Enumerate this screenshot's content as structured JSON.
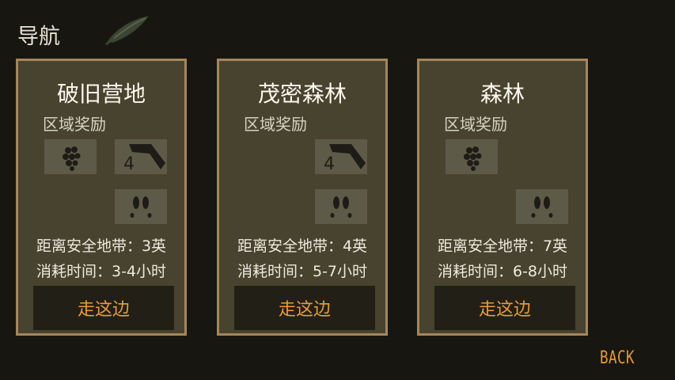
{
  "header": {
    "title": "导航",
    "icon": "leaf-compass-icon"
  },
  "colors": {
    "accent": "#eb9d33",
    "card_border": "#a4875b",
    "card_bg": "#48432e"
  },
  "cards": [
    {
      "title": "破旧营地",
      "reward_label": "区域奖励",
      "rewards": [
        "berries-icon",
        "hatchet-icon",
        "animal-tracks-icon"
      ],
      "distance_label": "距离安全地带：",
      "distance_value": "3英",
      "time_label": "消耗时间：",
      "time_value": "3-4小时",
      "go_label": "走这边"
    },
    {
      "title": "茂密森林",
      "reward_label": "区域奖励",
      "rewards": [
        "hatchet-icon",
        "animal-tracks-icon"
      ],
      "distance_label": "距离安全地带：",
      "distance_value": "4英",
      "time_label": "消耗时间：",
      "time_value": "5-7小时",
      "go_label": "走这边"
    },
    {
      "title": "森林",
      "reward_label": "区域奖励",
      "rewards": [
        "berries-icon",
        "animal-tracks-icon"
      ],
      "distance_label": "距离安全地带：",
      "distance_value": "7英",
      "time_label": "消耗时间：",
      "time_value": "6-8小时",
      "go_label": "走这边"
    }
  ],
  "back_label": "BACK"
}
